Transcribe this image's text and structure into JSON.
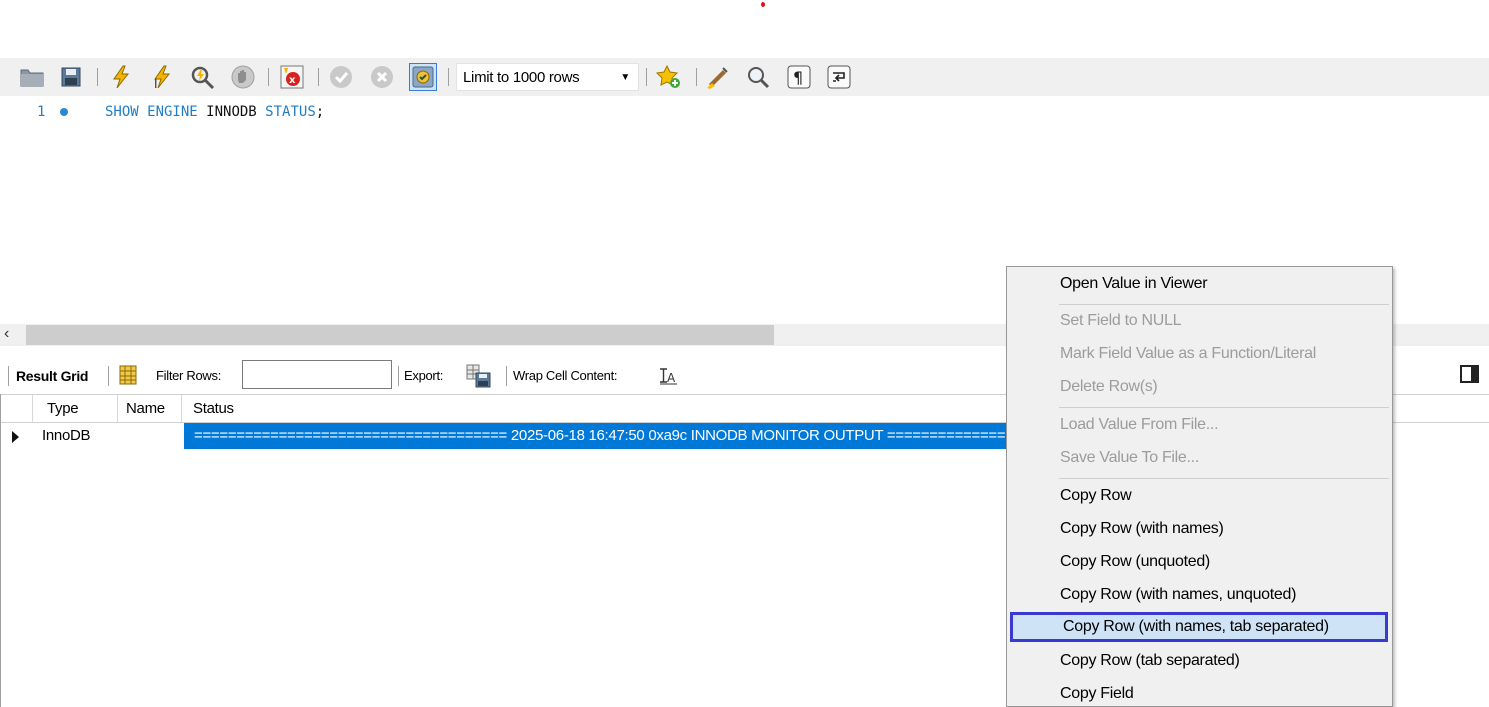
{
  "toolbar": {
    "limit_rows": "Limit to 1000 rows",
    "icons": [
      "folder-icon",
      "save-icon",
      "execute-icon",
      "execute-current-icon",
      "explain-icon",
      "stop-icon",
      "toggle-error-icon",
      "commit-icon",
      "rollback-icon",
      "autocommit-icon",
      "add-snippet-icon",
      "beautify-icon",
      "find-icon",
      "invisible-chars-icon",
      "word-wrap-icon"
    ]
  },
  "editor": {
    "line_number": "1",
    "code_kw1": "SHOW ENGINE",
    "code_plain": "INNODB",
    "code_kw2": "STATUS",
    "code_end": ";"
  },
  "result_toolbar": {
    "result_grid": "Result Grid",
    "filter_rows": "Filter Rows:",
    "filter_value": "",
    "export": "Export:",
    "wrap_cell": "Wrap Cell Content:"
  },
  "grid": {
    "columns": [
      "Type",
      "Name",
      "Status"
    ],
    "rows": [
      {
        "type": "InnoDB",
        "name": "",
        "status": "===================================== 2025-06-18 16:47:50 0xa9c INNODB MONITOR OUTPUT ====================================="
      }
    ]
  },
  "context_menu": {
    "items": [
      {
        "label": "Open Value in Viewer",
        "enabled": true
      },
      {
        "label": "Set Field to NULL",
        "enabled": false
      },
      {
        "label": "Mark Field Value as a Function/Literal",
        "enabled": false
      },
      {
        "label": "Delete Row(s)",
        "enabled": false
      },
      {
        "label": "Load Value From File...",
        "enabled": false
      },
      {
        "label": "Save Value To File...",
        "enabled": false
      },
      {
        "label": "Copy Row",
        "enabled": true
      },
      {
        "label": "Copy Row (with names)",
        "enabled": true
      },
      {
        "label": "Copy Row (unquoted)",
        "enabled": true
      },
      {
        "label": "Copy Row (with names, unquoted)",
        "enabled": true
      },
      {
        "label": "Copy Row (with names, tab separated)",
        "enabled": true,
        "highlighted": true
      },
      {
        "label": "Copy Row (tab separated)",
        "enabled": true
      },
      {
        "label": "Copy Field",
        "enabled": true
      }
    ]
  },
  "colors": {
    "keyword": "#1f7ec7",
    "selection": "#0078d7",
    "highlight_border": "#3a3ad0"
  }
}
